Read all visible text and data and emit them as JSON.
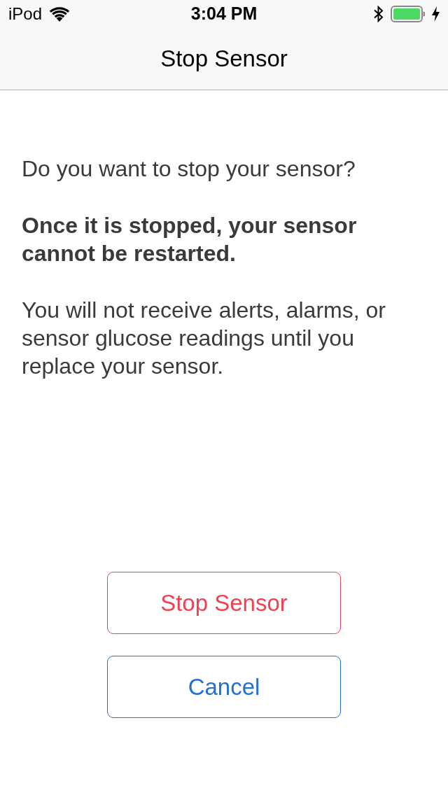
{
  "status_bar": {
    "carrier": "iPod",
    "time": "3:04 PM"
  },
  "nav_bar": {
    "title": "Stop Sensor"
  },
  "message": [
    {
      "text": "Do you want to stop your sensor?",
      "bold": false
    },
    {
      "text": "Once it is stopped, your sensor cannot be restarted.",
      "bold": true
    },
    {
      "text": "You will not receive alerts, alarms, or sensor glucose readings until you replace your sensor.",
      "bold": false
    }
  ],
  "buttons": [
    {
      "label": "Stop Sensor",
      "kind": "destructive"
    },
    {
      "label": "Cancel",
      "kind": "default"
    }
  ]
}
